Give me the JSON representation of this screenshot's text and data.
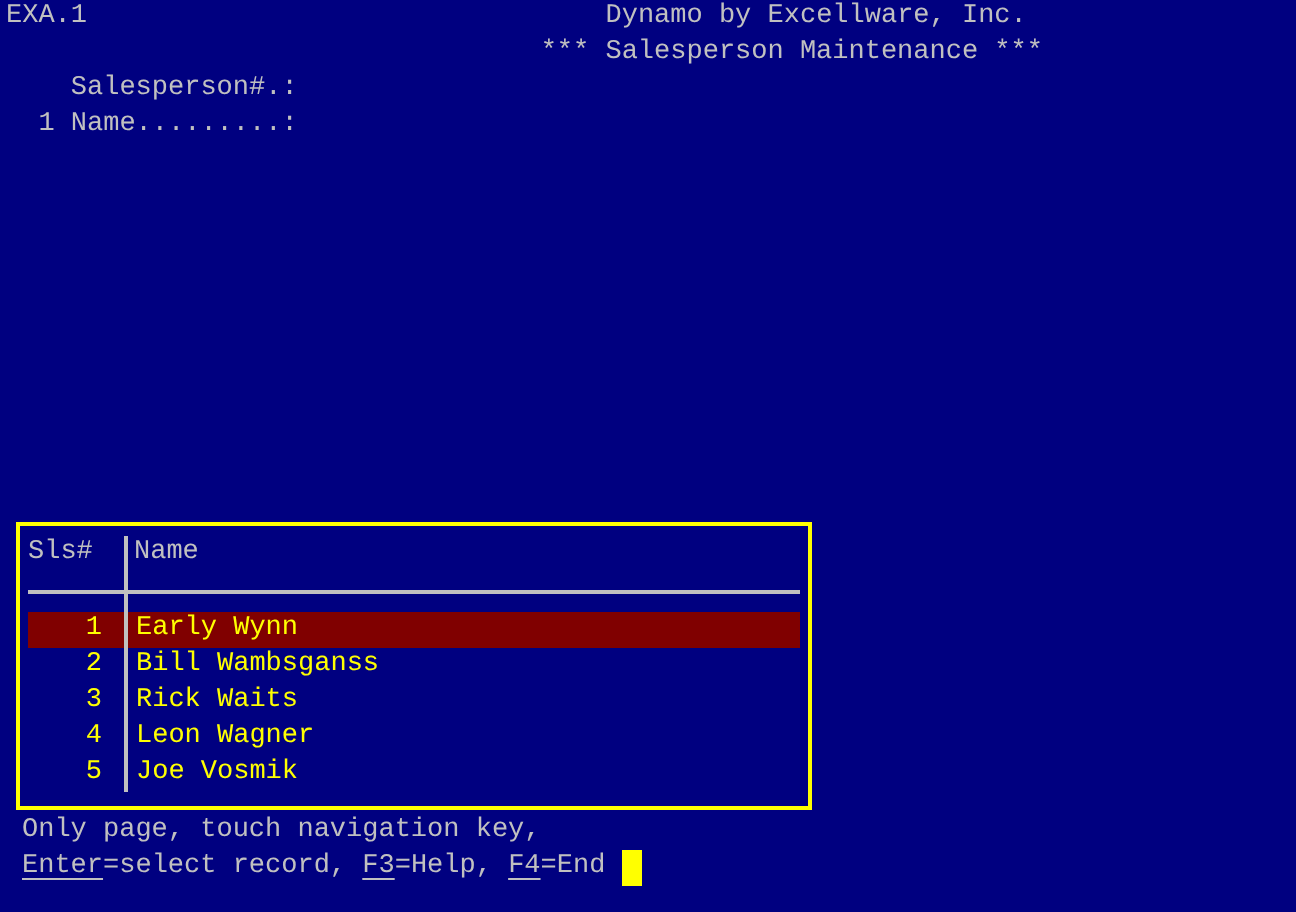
{
  "header": {
    "program_id": "EXA.1",
    "company": "Dynamo by Excellware, Inc.",
    "screen_title": "*** Salesperson Maintenance ***"
  },
  "fields": [
    {
      "label": "Salesperson#.:"
    },
    {
      "number": "1",
      "label": "Name.........:"
    }
  ],
  "lookup": {
    "columns": [
      "Sls#",
      "Name"
    ],
    "rows": [
      {
        "number": "1",
        "name": "Early Wynn",
        "selected": true
      },
      {
        "number": "2",
        "name": "Bill Wambsganss",
        "selected": false
      },
      {
        "number": "3",
        "name": "Rick Waits",
        "selected": false
      },
      {
        "number": "4",
        "name": "Leon Wagner",
        "selected": false
      },
      {
        "number": "5",
        "name": "Joe Vosmik",
        "selected": false
      }
    ]
  },
  "status_lines": [
    "Only page, touch navigation key,"
  ],
  "help_keys": [
    {
      "key": "Enter",
      "action": "=select record, "
    },
    {
      "key": "F3",
      "action": "=Help, "
    },
    {
      "key": "F4",
      "action": "=End"
    }
  ]
}
